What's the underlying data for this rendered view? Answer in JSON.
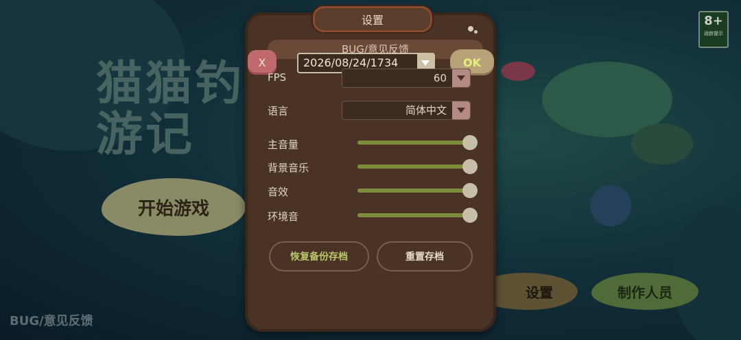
{
  "background": {
    "logo_text": "猫猫钓游记",
    "start_button": "开始游戏",
    "settings_button": "设置",
    "credits_button": "制作人员",
    "bug_link": "BUG/意见反馈",
    "age_badge": {
      "rating": "8+",
      "caption": "适龄提示"
    }
  },
  "settings_panel": {
    "title": "设置",
    "bug_bar": "BUG/意见反馈",
    "close_label": "X",
    "ok_label": "OK",
    "date_value": "2026/08/24/1734",
    "fps": {
      "label": "FPS",
      "value": "60"
    },
    "language": {
      "label": "语言",
      "value": "简体中文"
    },
    "volumes": [
      {
        "label": "主音量",
        "level": 1.0
      },
      {
        "label": "背景音乐",
        "level": 1.0
      },
      {
        "label": "音效",
        "level": 1.0
      },
      {
        "label": "环境音",
        "level": 1.0
      }
    ],
    "restore_backup_label": "恢复备份存档",
    "reset_save_label": "重置存档"
  },
  "colors": {
    "panel": "#4a3324",
    "slider_track": "#7c8c3a",
    "ok_text": "#e6f07a",
    "close_button": "#c06a6e"
  }
}
